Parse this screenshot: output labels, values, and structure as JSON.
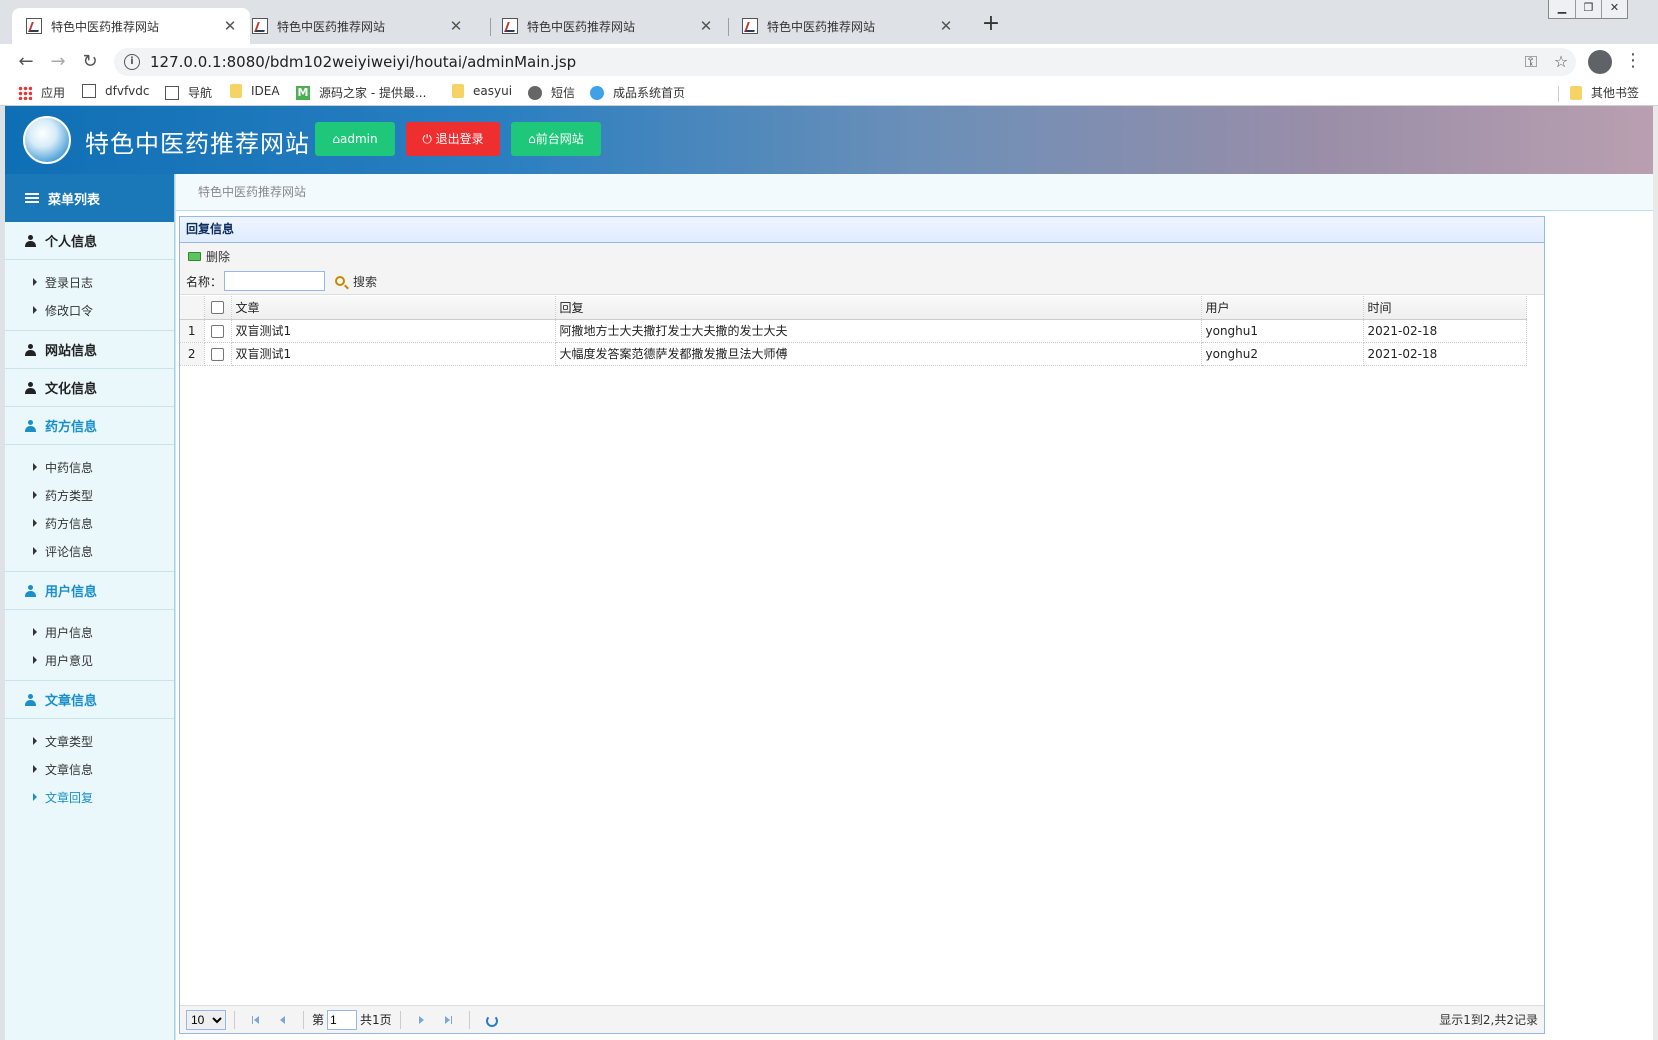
{
  "browser": {
    "tabs": [
      {
        "title": "特色中医药推荐网站"
      },
      {
        "title": "特色中医药推荐网站"
      },
      {
        "title": "特色中医药推荐网站"
      },
      {
        "title": "特色中医药推荐网站"
      }
    ],
    "url": "127.0.0.1:8080/bdm102weiyiweiyi/houtai/adminMain.jsp",
    "bookmarks": [
      "应用",
      "dfvfvdc",
      "导航",
      "IDEA",
      "源码之家 - 提供最...",
      "easyui",
      "短信",
      "成品系统首页"
    ],
    "other_bookmarks": "其他书签"
  },
  "header": {
    "site_title": "特色中医药推荐网站",
    "btn_admin": "admin",
    "btn_logout": "退出登录",
    "btn_front": "前台网站"
  },
  "sidebar": {
    "title": "菜单列表",
    "groups": [
      {
        "label": "个人信息",
        "items": [
          "登录日志",
          "修改口令"
        ]
      },
      {
        "label": "网站信息"
      },
      {
        "label": "文化信息"
      },
      {
        "label": "药方信息",
        "items": [
          "中药信息",
          "药方类型",
          "药方信息",
          "评论信息"
        ]
      },
      {
        "label": "用户信息",
        "items": [
          "用户信息",
          "用户意见"
        ]
      },
      {
        "label": "文章信息",
        "items": [
          "文章类型",
          "文章信息",
          "文章回复"
        ]
      }
    ]
  },
  "main": {
    "breadcrumb": "特色中医药推荐网站",
    "panel_title": "回复信息",
    "delete_label": "删除",
    "search_label": "名称：",
    "search_value": "",
    "search_button": "搜索",
    "columns": [
      "文章",
      "回复",
      "用户",
      "时间"
    ],
    "rows": [
      {
        "no": "1",
        "article": "双盲测试1",
        "reply": "阿撒地方士大夫撒打发士大夫撒的发士大夫",
        "user": "yonghu1",
        "time": "2021-02-18"
      },
      {
        "no": "2",
        "article": "双盲测试1",
        "reply": "大幅度发答案范德萨发都撒发撒旦法大师傅",
        "user": "yonghu2",
        "time": "2021-02-18"
      }
    ],
    "pager": {
      "page_size": "10",
      "page_prefix": "第",
      "page_value": "1",
      "page_total": "共1页",
      "info": "显示1到2,共2记录"
    }
  }
}
